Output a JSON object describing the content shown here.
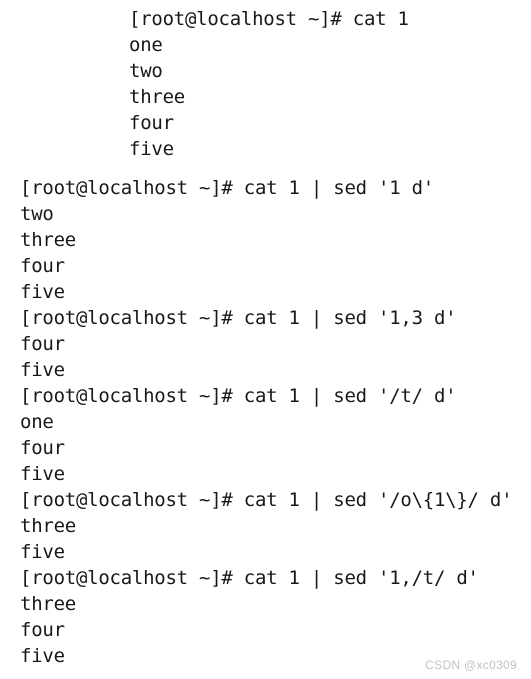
{
  "terminal": {
    "prompt": "[root@localhost ~]#",
    "background_color": "#ffffff",
    "text_color": "#181818",
    "blocks": [
      {
        "id": "cat-1",
        "indented": true,
        "command_line": "[root@localhost ~]# cat 1",
        "output_lines": [
          "one",
          "two",
          "three",
          "four",
          "five"
        ]
      },
      {
        "id": "sed-1-d",
        "indented": false,
        "command_line": "[root@localhost ~]# cat 1 | sed '1 d'",
        "output_lines": [
          "two",
          "three",
          "four",
          "five"
        ]
      },
      {
        "id": "sed-1-3-d",
        "indented": false,
        "command_line": "[root@localhost ~]# cat 1 | sed '1,3 d'",
        "output_lines": [
          "four",
          "five"
        ]
      },
      {
        "id": "sed-slash-t-d",
        "indented": false,
        "command_line": "[root@localhost ~]# cat 1 | sed '/t/ d'",
        "output_lines": [
          "one",
          "four",
          "five"
        ]
      },
      {
        "id": "sed-o-brace-d",
        "indented": false,
        "command_line": "[root@localhost ~]# cat 1 | sed '/o\\{1\\}/ d'",
        "output_lines": [
          "three",
          "five"
        ]
      },
      {
        "id": "sed-1-slash-t-d",
        "indented": false,
        "command_line": "[root@localhost ~]# cat 1 | sed '1,/t/ d'",
        "output_lines": [
          "three",
          "four",
          "five"
        ]
      }
    ]
  },
  "watermark": {
    "text": "CSDN @xc0309",
    "color": "#c2c2c2"
  }
}
